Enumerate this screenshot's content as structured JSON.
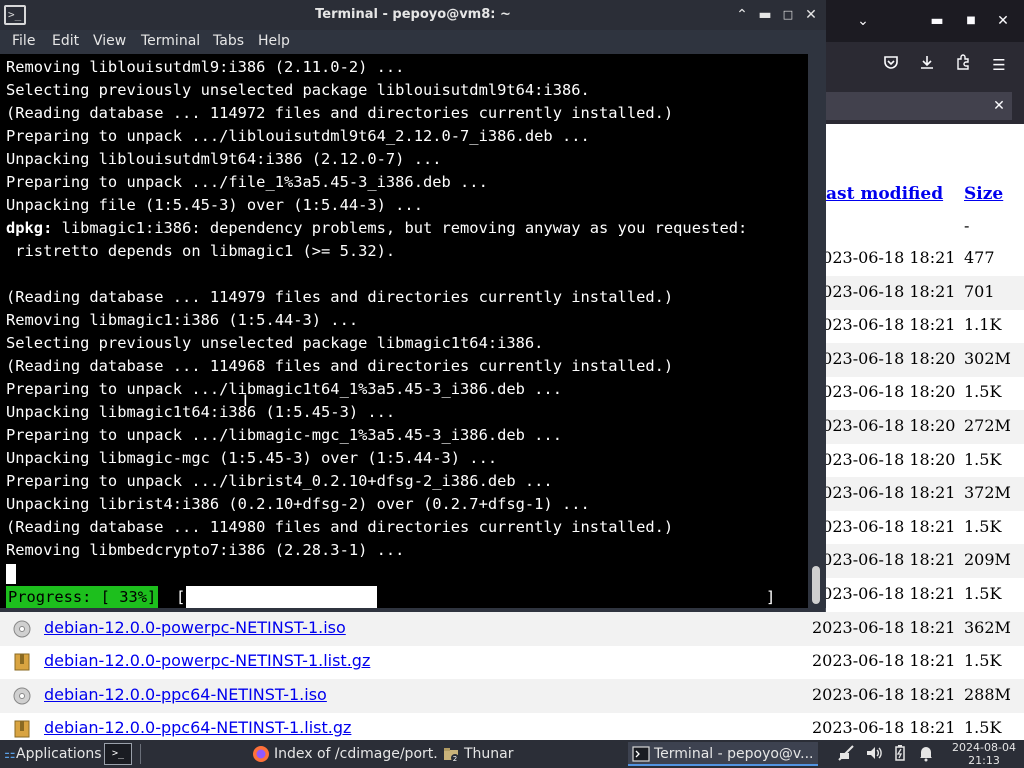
{
  "browser": {
    "header": {
      "last_modified": "ast modified",
      "size": "Size"
    },
    "parent_size": "-",
    "rows": [
      {
        "name": "",
        "date": "2023-06-18 18:21",
        "size": "477"
      },
      {
        "name": "",
        "date": "2023-06-18 18:21",
        "size": "701"
      },
      {
        "name": "",
        "date": "2023-06-18 18:21",
        "size": "1.1K"
      },
      {
        "name": "",
        "date": "2023-06-18 18:20",
        "size": "302M"
      },
      {
        "name": "",
        "date": "2023-06-18 18:20",
        "size": "1.5K"
      },
      {
        "name": "",
        "date": "2023-06-18 18:20",
        "size": "272M"
      },
      {
        "name": "",
        "date": "2023-06-18 18:20",
        "size": "1.5K"
      },
      {
        "name": "",
        "date": "2023-06-18 18:21",
        "size": "372M"
      },
      {
        "name": "",
        "date": "2023-06-18 18:21",
        "size": "1.5K"
      },
      {
        "name": "",
        "date": "2023-06-18 18:21",
        "size": "209M"
      },
      {
        "name": "",
        "date": "2023-06-18 18:21",
        "size": "1.5K"
      },
      {
        "name": "debian-12.0.0-powerpc-NETINST-1.iso",
        "date": "2023-06-18 18:21",
        "size": "362M"
      },
      {
        "name": "debian-12.0.0-powerpc-NETINST-1.list.gz",
        "date": "2023-06-18 18:21",
        "size": "1.5K"
      },
      {
        "name": "debian-12.0.0-ppc64-NETINST-1.iso",
        "date": "2023-06-18 18:21",
        "size": "288M"
      },
      {
        "name": "debian-12.0.0-ppc64-NETINST-1.list.gz",
        "date": "2023-06-18 18:21",
        "size": "1.5K"
      }
    ]
  },
  "terminal": {
    "title": "Terminal - pepoyo@vm8: ~",
    "menu": [
      "File",
      "Edit",
      "View",
      "Terminal",
      "Tabs",
      "Help"
    ],
    "lines": [
      "Removing liblouisutdml9:i386 (2.11.0-2) ...",
      "Selecting previously unselected package liblouisutdml9t64:i386.",
      "(Reading database ... 114972 files and directories currently installed.)",
      "Preparing to unpack .../liblouisutdml9t64_2.12.0-7_i386.deb ...",
      "Unpacking liblouisutdml9t64:i386 (2.12.0-7) ...",
      "Preparing to unpack .../file_1%3a5.45-3_i386.deb ...",
      "Unpacking file (1:5.45-3) over (1:5.44-3) ...",
      "",
      " ristretto depends on libmagic1 (>= 5.32).",
      "",
      "(Reading database ... 114979 files and directories currently installed.)",
      "Removing libmagic1:i386 (1:5.44-3) ...",
      "Selecting previously unselected package libmagic1t64:i386.",
      "(Reading database ... 114968 files and directories currently installed.)",
      "Preparing to unpack .../libmagic1t64_1%3a5.45-3_i386.deb ...",
      "Unpacking libmagic1t64:i386 (1:5.45-3) ...",
      "Preparing to unpack .../libmagic-mgc_1%3a5.45-3_i386.deb ...",
      "Unpacking libmagic-mgc (1:5.45-3) over (1:5.44-3) ...",
      "Preparing to unpack .../librist4_0.2.10+dfsg-2_i386.deb ...",
      "Unpacking librist4:i386 (0.2.10+dfsg-2) over (0.2.7+dfsg-1) ...",
      "(Reading database ... 114980 files and directories currently installed.)",
      "Removing libmbedcrypto7:i386 (2.28.3-1) ..."
    ],
    "dpkg_prefix": "dpkg:",
    "dpkg_rest": " libmagic1:i386: dependency problems, but removing anyway as you requested:",
    "progress_label": "Progress: [ 33%]",
    "progress_open": "[",
    "progress_close": "]",
    "progress_fraction": 0.33
  },
  "taskbar": {
    "applications": "Applications",
    "windows": [
      {
        "label": "Index of /cdimage/port...",
        "active": false
      },
      {
        "label": "Thunar",
        "active": false
      },
      {
        "label": "Terminal - pepoyo@v...",
        "active": true
      }
    ],
    "clock_date": "2024-08-04",
    "clock_time": "21:13"
  },
  "colors": {
    "progress_green": "#1dbf1d",
    "link": "#0000ee",
    "terminal_bg": "#000000",
    "chrome_dark": "#2b2e37"
  }
}
